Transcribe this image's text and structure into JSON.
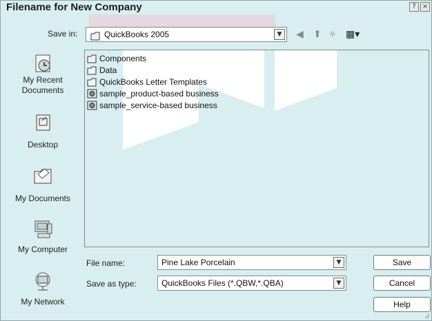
{
  "window": {
    "title": "Filename for New Company"
  },
  "save_in": {
    "label": "Save in:",
    "value": "QuickBooks 2005"
  },
  "places": [
    {
      "label": "My Recent Documents",
      "icon": "recent-documents-icon"
    },
    {
      "label": "Desktop",
      "icon": "desktop-icon"
    },
    {
      "label": "My Documents",
      "icon": "my-documents-icon"
    },
    {
      "label": "My Computer",
      "icon": "computer-icon"
    },
    {
      "label": "My Network",
      "icon": "network-icon"
    }
  ],
  "files": [
    {
      "name": "Components",
      "icon": "folder-icon"
    },
    {
      "name": "Data",
      "icon": "folder-icon"
    },
    {
      "name": "QuickBooks Letter Templates",
      "icon": "folder-icon"
    },
    {
      "name": "sample_product-based business",
      "icon": "quickbooks-file-icon"
    },
    {
      "name": "sample_service-based business",
      "icon": "quickbooks-file-icon"
    }
  ],
  "file_name": {
    "label": "File name:",
    "value": "Pine Lake Porcelain"
  },
  "save_as_type": {
    "label": "Save as type:",
    "value": "QuickBooks Files (*.QBW,*.QBA)"
  },
  "buttons": {
    "save": "Save",
    "cancel": "Cancel",
    "help": "Help"
  },
  "title_buttons": {
    "help": "?",
    "close": "×"
  }
}
